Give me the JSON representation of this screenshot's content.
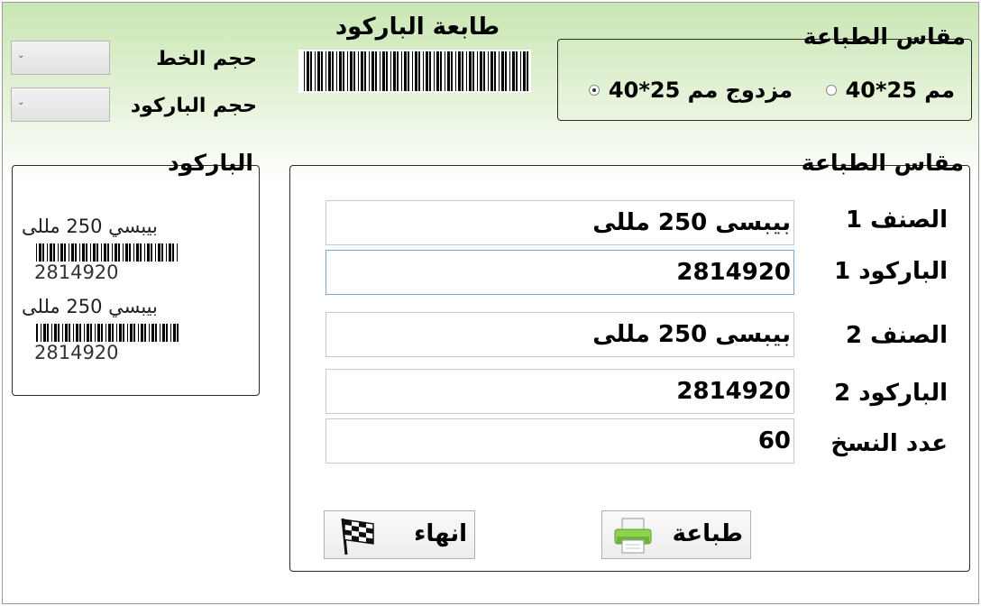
{
  "header": {
    "title": "طابعة الباركود",
    "font_size_label": "حجم الخط",
    "barcode_size_label": "حجم الباركود"
  },
  "print_size_group": {
    "title": "مقاس الطباعة",
    "options": [
      {
        "label": "مم 25*40",
        "selected": false
      },
      {
        "label": "مزدوج مم 25*40",
        "selected": true
      }
    ]
  },
  "barcode_preview": {
    "title": "الباركود",
    "items": [
      {
        "name": "بيبسي 250 مللى",
        "number": "2814920"
      },
      {
        "name": "بيبسي 250 مللى",
        "number": "2814920"
      }
    ]
  },
  "form_group": {
    "title": "مقاس الطباعة",
    "fields": [
      {
        "label": "الصنف 1",
        "value": "بيبسى 250 مللى"
      },
      {
        "label": "الباركود 1",
        "value": "2814920"
      },
      {
        "label": "الصنف 2",
        "value": "بيبسى 250 مللى"
      },
      {
        "label": "الباركود 2",
        "value": "2814920"
      },
      {
        "label": "عدد النسخ",
        "value": "60"
      }
    ],
    "print_button": "طباعة",
    "exit_button": "انهاء"
  }
}
